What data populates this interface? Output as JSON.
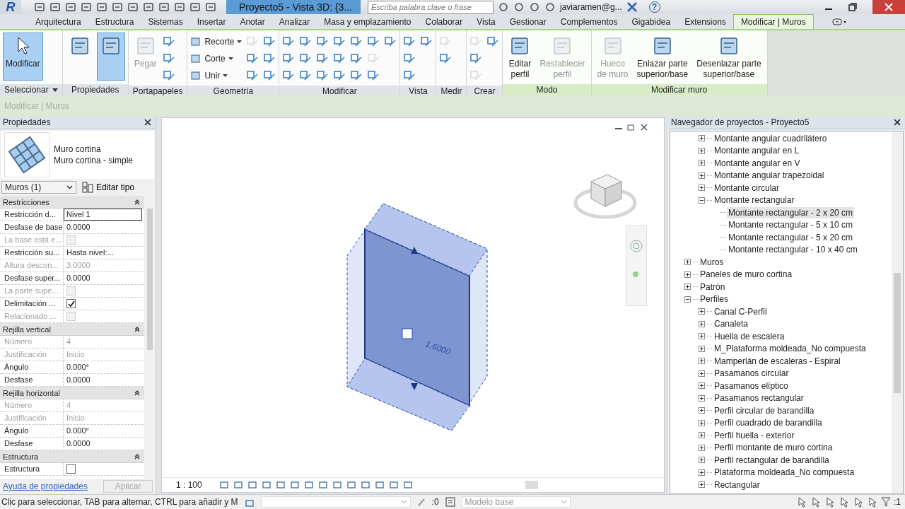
{
  "titlebar": {
    "logo": "R",
    "title": "Proyecto5 - Vista 3D: {3...",
    "search": {
      "placeholder": "Escriba palabra clave o frase"
    },
    "user": "javiaramen@g...",
    "help": "?"
  },
  "tabs": [
    {
      "label": "Arquitectura",
      "selected": false
    },
    {
      "label": "Estructura",
      "selected": false
    },
    {
      "label": "Sistemas",
      "selected": false
    },
    {
      "label": "Insertar",
      "selected": false
    },
    {
      "label": "Anotar",
      "selected": false
    },
    {
      "label": "Analizar",
      "selected": false
    },
    {
      "label": "Masa y emplazamiento",
      "selected": false
    },
    {
      "label": "Colaborar",
      "selected": false
    },
    {
      "label": "Vista",
      "selected": false
    },
    {
      "label": "Gestionar",
      "selected": false
    },
    {
      "label": "Complementos",
      "selected": false
    },
    {
      "label": "Gigabidea",
      "selected": false
    },
    {
      "label": "Extensions",
      "selected": false
    },
    {
      "label": "Modificar | Muros",
      "selected": true
    }
  ],
  "ribbon": [
    {
      "title": "Seleccionar",
      "dropdown": true,
      "contextual": false,
      "tools": [
        {
          "kind": "large",
          "label": "Modificar",
          "selected": true,
          "disabled": false
        }
      ]
    },
    {
      "title": "Propiedades",
      "dropdown": false,
      "contextual": false,
      "tools": [
        {
          "kind": "large",
          "selected": false,
          "disabled": false
        },
        {
          "kind": "large",
          "selected": true,
          "disabled": false
        }
      ]
    },
    {
      "title": "Portapapeles",
      "dropdown": false,
      "contextual": false,
      "tools": [
        {
          "kind": "large",
          "label": "Pegar",
          "selected": false,
          "disabled": true
        },
        {
          "kind": "icon",
          "disabled": false
        },
        {
          "kind": "icon",
          "disabled": false
        },
        {
          "kind": "icon",
          "disabled": false
        }
      ]
    },
    {
      "title": "Geometría",
      "dropdown": false,
      "contextual": false,
      "tools": [
        {
          "kind": "small",
          "label": "Recorte",
          "disabled": false
        },
        {
          "kind": "small",
          "label": "Corte",
          "disabled": false
        },
        {
          "kind": "small",
          "label": "Unir",
          "disabled": false
        },
        {
          "kind": "icon",
          "disabled": true
        },
        {
          "kind": "icon",
          "disabled": false
        },
        {
          "kind": "icon",
          "disabled": false
        },
        {
          "kind": "icon",
          "disabled": false
        },
        {
          "kind": "icon",
          "disabled": false
        },
        {
          "kind": "icon",
          "disabled": false
        }
      ]
    },
    {
      "title": "Modificar",
      "dropdown": false,
      "contextual": false,
      "tools": [
        {
          "kind": "icon",
          "disabled": false
        },
        {
          "kind": "icon",
          "disabled": false
        },
        {
          "kind": "icon",
          "disabled": false
        },
        {
          "kind": "icon",
          "disabled": false
        },
        {
          "kind": "icon",
          "disabled": false
        },
        {
          "kind": "icon",
          "disabled": false
        },
        {
          "kind": "icon",
          "disabled": false
        },
        {
          "kind": "icon",
          "disabled": false
        },
        {
          "kind": "icon",
          "disabled": false
        },
        {
          "kind": "icon",
          "disabled": false
        },
        {
          "kind": "icon",
          "disabled": false
        },
        {
          "kind": "icon",
          "disabled": false
        },
        {
          "kind": "icon",
          "disabled": false
        },
        {
          "kind": "icon",
          "disabled": false
        },
        {
          "kind": "icon",
          "disabled": false
        },
        {
          "kind": "icon",
          "disabled": false
        },
        {
          "kind": "icon",
          "disabled": true
        },
        {
          "kind": "icon",
          "disabled": false
        },
        {
          "kind": "icon",
          "disabled": false
        }
      ]
    },
    {
      "title": "Vista",
      "dropdown": false,
      "contextual": false,
      "tools": [
        {
          "kind": "icon",
          "disabled": false
        },
        {
          "kind": "icon",
          "disabled": false
        },
        {
          "kind": "icon",
          "disabled": false
        },
        {
          "kind": "icon",
          "disabled": false
        }
      ]
    },
    {
      "title": "Medir",
      "dropdown": false,
      "contextual": false,
      "tools": [
        {
          "kind": "icon",
          "disabled": true
        },
        {
          "kind": "icon",
          "disabled": false
        }
      ]
    },
    {
      "title": "Crear",
      "dropdown": false,
      "contextual": false,
      "tools": [
        {
          "kind": "icon",
          "disabled": true
        },
        {
          "kind": "icon",
          "disabled": false
        },
        {
          "kind": "icon",
          "disabled": true
        },
        {
          "kind": "icon",
          "disabled": false
        }
      ]
    },
    {
      "title": "Modo",
      "dropdown": false,
      "contextual": true,
      "tools": [
        {
          "kind": "large",
          "label": "Editar\nperfil",
          "selected": false,
          "disabled": false
        },
        {
          "kind": "large",
          "label": "Restablecer\nperfil",
          "selected": false,
          "disabled": true
        }
      ]
    },
    {
      "title": "Modificar muro",
      "dropdown": false,
      "contextual": true,
      "tools": [
        {
          "kind": "large",
          "label": "Hueco\nde muro",
          "selected": false,
          "disabled": true
        },
        {
          "kind": "large",
          "label": "Enlazar parte\nsuperior/base",
          "selected": false,
          "disabled": false
        },
        {
          "kind": "large",
          "label": "Desenlazar parte\nsuperior/base",
          "selected": false,
          "disabled": false
        }
      ]
    }
  ],
  "context_label": "Modificar | Muros",
  "properties": {
    "title": "Propiedades",
    "type_family": "Muro cortina",
    "type_name": "Muro cortina - simple",
    "selector": "Muros (1)",
    "edit_type": "Editar tipo",
    "groups": [
      {
        "title": "Restricciones",
        "rows": [
          {
            "label": "Restricción d...",
            "kind": "text",
            "value": "Nivel 1",
            "disabled": false,
            "selected": true
          },
          {
            "label": "Desfase de base",
            "kind": "text",
            "value": "0.0000",
            "disabled": false,
            "selected": false
          },
          {
            "label": "La base está e...",
            "kind": "checkbox",
            "checked": false,
            "disabled": true,
            "selected": false
          },
          {
            "label": "Restricción su...",
            "kind": "text",
            "value": "Hasta nivel:...",
            "disabled": false,
            "selected": false
          },
          {
            "label": "Altura descon...",
            "kind": "text",
            "value": "3.0000",
            "disabled": true,
            "selected": false
          },
          {
            "label": "Desfase super...",
            "kind": "text",
            "value": "0.0000",
            "disabled": false,
            "selected": false
          },
          {
            "label": "La parte supe...",
            "kind": "checkbox",
            "checked": false,
            "disabled": true,
            "selected": false
          },
          {
            "label": "Delimitación ...",
            "kind": "checkbox",
            "checked": true,
            "disabled": false,
            "selected": false
          },
          {
            "label": "Relacionado ...",
            "kind": "checkbox",
            "checked": false,
            "disabled": true,
            "selected": false
          }
        ]
      },
      {
        "title": "Rejilla vertical",
        "rows": [
          {
            "label": "Número",
            "kind": "text",
            "value": "4",
            "disabled": true,
            "selected": false
          },
          {
            "label": "Justificación",
            "kind": "text",
            "value": "Inicio",
            "disabled": true,
            "selected": false
          },
          {
            "label": "Ángulo",
            "kind": "text",
            "value": "0.000°",
            "disabled": false,
            "selected": false
          },
          {
            "label": "Desfase",
            "kind": "text",
            "value": "0.0000",
            "disabled": false,
            "selected": false
          }
        ]
      },
      {
        "title": "Rejilla horizontal",
        "rows": [
          {
            "label": "Número",
            "kind": "text",
            "value": "4",
            "disabled": true,
            "selected": false
          },
          {
            "label": "Justificación",
            "kind": "text",
            "value": "Inicio",
            "disabled": true,
            "selected": false
          },
          {
            "label": "Ángulo",
            "kind": "text",
            "value": "0.000°",
            "disabled": false,
            "selected": false
          },
          {
            "label": "Desfase",
            "kind": "text",
            "value": "0.0000",
            "disabled": false,
            "selected": false
          }
        ]
      },
      {
        "title": "Estructura",
        "rows": [
          {
            "label": "Estructura",
            "kind": "checkbox",
            "checked": false,
            "disabled": false,
            "selected": false
          }
        ]
      }
    ],
    "help_link": "Ayuda de propiedades",
    "apply": {
      "label": "Aplicar",
      "disabled": true
    }
  },
  "view": {
    "scale": "1 : 100",
    "dimension": "1.6000"
  },
  "browser": {
    "title": "Navegador de proyectos - Proyecto5",
    "tree": [
      {
        "kind": "continued",
        "children": [
          {
            "kind": "folder",
            "label": "Montante angular cuadrilátero",
            "expanded": false,
            "selected": false
          },
          {
            "kind": "folder",
            "label": "Montante angular en L",
            "expanded": false,
            "selected": false
          },
          {
            "kind": "folder",
            "label": "Montante angular en V",
            "expanded": false,
            "selected": false
          },
          {
            "kind": "folder",
            "label": "Montante angular trapezoidal",
            "expanded": false,
            "selected": false
          },
          {
            "kind": "folder",
            "label": "Montante circular",
            "expanded": false,
            "selected": false
          },
          {
            "kind": "folder",
            "label": "Montante rectangular",
            "expanded": true,
            "selected": false,
            "children": [
              {
                "kind": "leaf",
                "label": "Montante rectangular - 2 x 20 cm",
                "selected": true
              },
              {
                "kind": "leaf",
                "label": "Montante rectangular - 5 x 10 cm",
                "selected": false
              },
              {
                "kind": "leaf",
                "label": "Montante rectangular - 5 x 20 cm",
                "selected": false
              },
              {
                "kind": "leaf",
                "label": "Montante rectangular - 10 x 40 cm",
                "selected": false
              }
            ]
          }
        ]
      },
      {
        "kind": "folder",
        "label": "Muros",
        "expanded": false,
        "selected": false
      },
      {
        "kind": "folder",
        "label": "Paneles de muro cortina",
        "expanded": false,
        "selected": false
      },
      {
        "kind": "folder",
        "label": "Patrón",
        "expanded": false,
        "selected": false
      },
      {
        "kind": "folder",
        "label": "Perfiles",
        "expanded": true,
        "selected": false,
        "children": [
          {
            "kind": "folder",
            "label": "Canal C-Perfil",
            "expanded": false,
            "selected": false
          },
          {
            "kind": "folder",
            "label": "Canaleta",
            "expanded": false,
            "selected": false
          },
          {
            "kind": "folder",
            "label": "Huella de escalera",
            "expanded": false,
            "selected": false
          },
          {
            "kind": "folder",
            "label": "M_Plataforma moldeada_No compuesta",
            "expanded": false,
            "selected": false
          },
          {
            "kind": "folder",
            "label": "Mamperlán de escaleras - Espiral",
            "expanded": false,
            "selected": false
          },
          {
            "kind": "folder",
            "label": "Pasamanos circular",
            "expanded": false,
            "selected": false
          },
          {
            "kind": "folder",
            "label": "Pasamanos elíptico",
            "expanded": false,
            "selected": false
          },
          {
            "kind": "folder",
            "label": "Pasamanos rectangular",
            "expanded": false,
            "selected": false
          },
          {
            "kind": "folder",
            "label": "Perfil circular de barandilla",
            "expanded": false,
            "selected": false
          },
          {
            "kind": "folder",
            "label": "Perfil cuadrado de barandilla",
            "expanded": false,
            "selected": false
          },
          {
            "kind": "folder",
            "label": "Perfil huella - exterior",
            "expanded": false,
            "selected": false
          },
          {
            "kind": "folder",
            "label": "Perfil montante de muro cortina",
            "expanded": false,
            "selected": false
          },
          {
            "kind": "folder",
            "label": "Perfil rectangular de barandilla",
            "expanded": false,
            "selected": false
          },
          {
            "kind": "folder",
            "label": "Plataforma moldeada_No compuesta",
            "expanded": false,
            "selected": false
          },
          {
            "kind": "folder",
            "label": "Rectangular",
            "expanded": false,
            "selected": false
          }
        ]
      }
    ]
  },
  "status": {
    "message": "Clic para seleccionar, TAB para alternar, CTRL para añadir y M",
    "count": ":0",
    "model": "Modelo base",
    "filter_count": ":1"
  }
}
